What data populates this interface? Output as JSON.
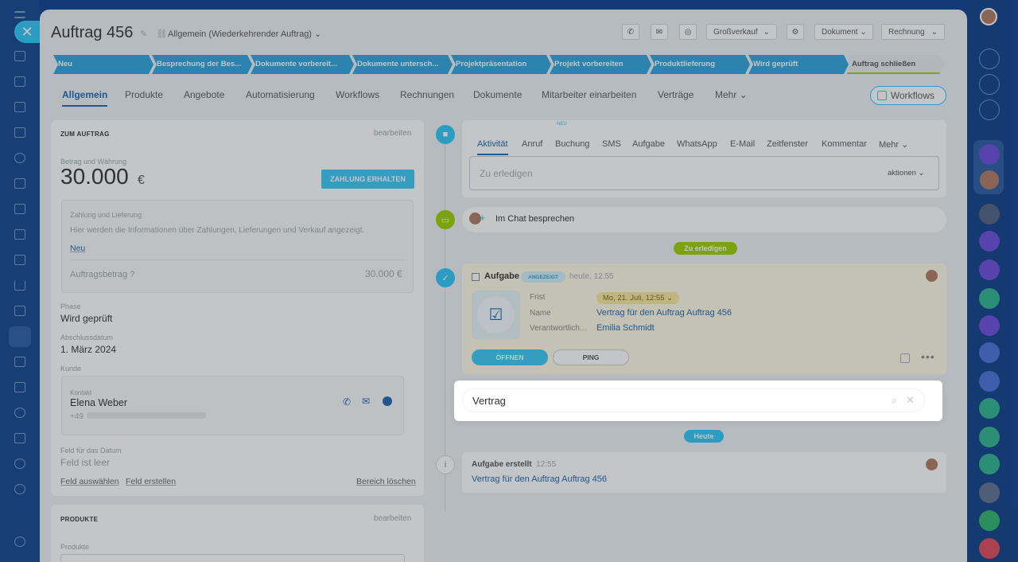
{
  "header": {
    "title": "Auftrag 456",
    "category": "Allgemein (Wiederkehrender Auftrag)",
    "buttons": {
      "sales": "Großverkauf",
      "document": "Dokument",
      "invoice": "Rechnung"
    },
    "top_badge": "NEU"
  },
  "stages": [
    {
      "label": "Neu",
      "color": "#2ea5dd"
    },
    {
      "label": "Besprechung der Bes...",
      "color": "#2ea5dd"
    },
    {
      "label": "Dokumente vorbereit...",
      "color": "#2ea5dd"
    },
    {
      "label": "Dokumente untersch...",
      "color": "#2ea5dd"
    },
    {
      "label": "Projektpräsentation",
      "color": "#2ea5dd"
    },
    {
      "label": "Projekt vorbereiten",
      "color": "#2ea5dd"
    },
    {
      "label": "Produktlieferung",
      "color": "#2ea5dd"
    },
    {
      "label": "Wird geprüft",
      "color": "#2ea5dd"
    },
    {
      "label": "Auftrag schließen",
      "color": "#e9ecef"
    }
  ],
  "tabs": [
    "Allgemein",
    "Produkte",
    "Angebote",
    "Automatisierung",
    "Workflows",
    "Rechnungen",
    "Dokumente",
    "Mitarbeiter einarbeiten",
    "Verträge",
    "Mehr"
  ],
  "workflows_button": "Workflows",
  "order": {
    "section_title": "ZUM AUFTRAG",
    "edit": "bearbeiten",
    "amount_label": "Betrag und Währung",
    "amount": "30.000",
    "currency": "€",
    "pay_button": "ZAHLUNG ERHALTEN",
    "payment_title": "Zahlung und Lieferung",
    "payment_text": "Hier werden die Informationen über Zahlungen, Lieferungen und Verkauf angezeigt.",
    "payment_link": "Neu",
    "order_amount_label": "Auftragsbetrag",
    "order_amount": "30.000 €",
    "phase_label": "Phase",
    "phase": "Wird geprüft",
    "close_date_label": "Abschlussdatum",
    "close_date": "1. März 2024",
    "customer_label": "Kunde",
    "contact_label": "Kontakt",
    "contact_name": "Elena Weber",
    "contact_phone": "+49",
    "date_field_label": "Feld für das Datum",
    "date_field_value": "Feld ist leer",
    "select_field": "Feld auswählen",
    "create_field": "Feld erstellen",
    "delete_section": "Bereich löschen"
  },
  "products": {
    "section_title": "PRODUKTE",
    "edit": "bearbeiten",
    "label": "Produkte"
  },
  "activity_tabs": [
    "Aktivität",
    "Anruf",
    "Buchung",
    "SMS",
    "Aufgabe",
    "WhatsApp",
    "E-Mail",
    "Zeitfenster",
    "Kommentar",
    "Mehr"
  ],
  "booking_badge": "NEU",
  "todo": {
    "placeholder": "Zu erledigen",
    "actions": "aktionen"
  },
  "chat": {
    "label": "Im Chat besprechen"
  },
  "todo_pill": "Zu erledigen",
  "task": {
    "title": "Aufgabe",
    "badge": "ANGEZEIGT",
    "time": "heute, 12:55",
    "deadline_label": "Frist",
    "deadline": "Mo, 21. Juli, 12:55",
    "name_label": "Name",
    "name": "Vertrag für den Auftrag Auftrag 456",
    "responsible_label": "Verantwortlich...",
    "responsible": "Emilia Schmidt",
    "open_button": "ÖFFNEN",
    "ping_button": "PING"
  },
  "search": {
    "value": "Vertrag",
    "placeholder": ""
  },
  "today_pill": "Heute",
  "created": {
    "title": "Aufgabe erstellt",
    "time": "12:55",
    "text": "Vertrag für den Auftrag Auftrag 456"
  },
  "colors": {
    "accent": "#2fc6f6",
    "link": "#2067b0",
    "green": "#9dcf00",
    "stage": "#2ea5dd"
  }
}
